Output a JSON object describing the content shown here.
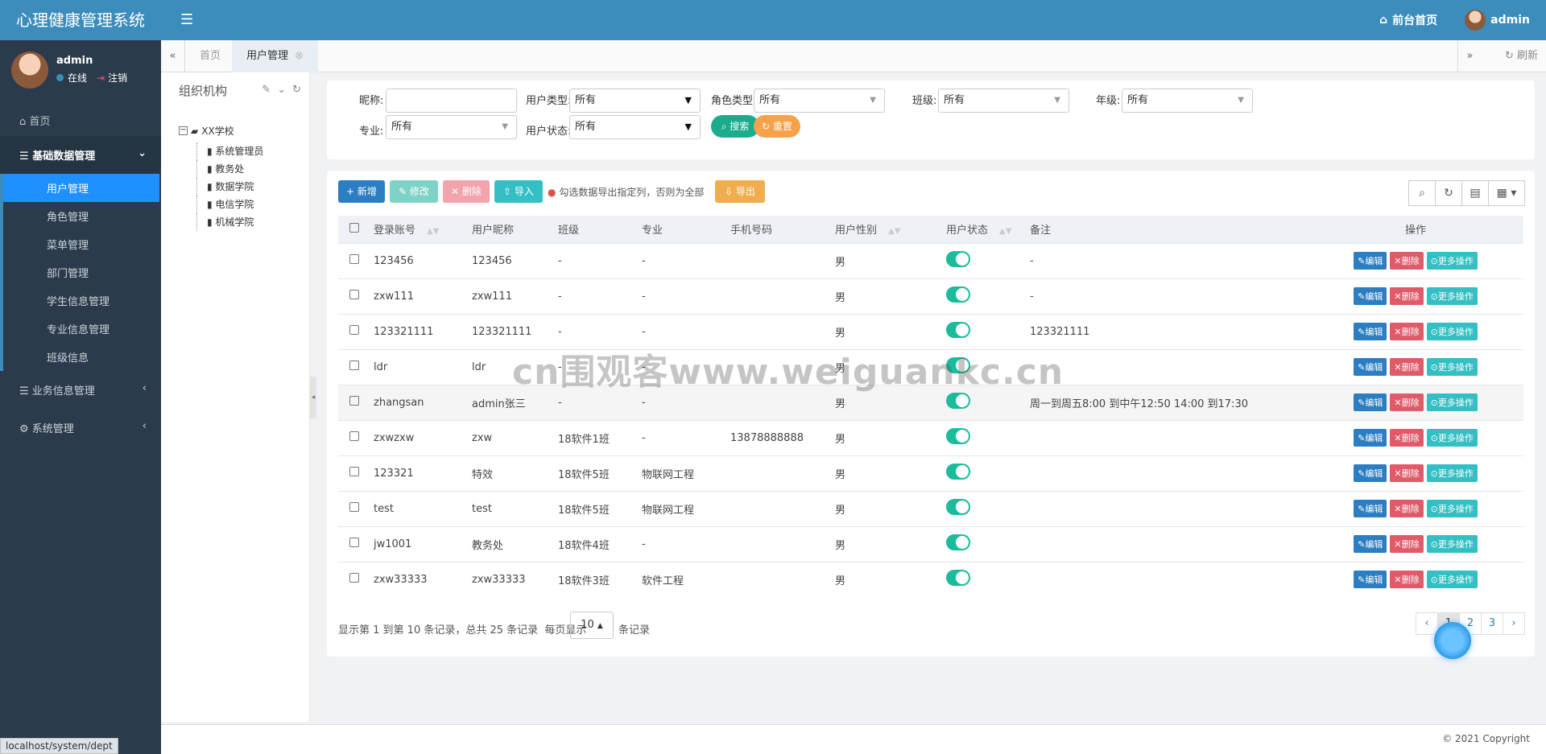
{
  "app": {
    "title": "心理健康管理系统"
  },
  "topbar": {
    "home_link": "前台首页",
    "user": "admin"
  },
  "sidebar": {
    "user": "admin",
    "status_online": "在线",
    "logout": "注销",
    "home": "首页",
    "group_basic": "基础数据管理",
    "sub_items": [
      "用户管理",
      "角色管理",
      "菜单管理",
      "部门管理",
      "学生信息管理",
      "专业信息管理",
      "班级信息"
    ],
    "group_business": "业务信息管理",
    "group_system": "系统管理"
  },
  "tabs": {
    "items": [
      "首页",
      "用户管理"
    ],
    "refresh": "刷新"
  },
  "org": {
    "title": "组织机构",
    "root": "XX学校",
    "children": [
      "系统管理员",
      "教务处",
      "数据学院",
      "电信学院",
      "机械学院"
    ]
  },
  "filter": {
    "nickname_label": "昵称:",
    "nickname_value": "",
    "user_type_label": "用户类型:",
    "user_type_value": "所有",
    "role_type_label": "角色类型:",
    "role_type_value": "所有",
    "class_label": "班级:",
    "class_value": "所有",
    "grade_label": "年级:",
    "grade_value": "所有",
    "major_label": "专业:",
    "major_value": "所有",
    "user_status_label": "用户状态:",
    "user_status_value": "所有",
    "search_btn": "搜索",
    "reset_btn": "重置"
  },
  "toolbar": {
    "add": "新增",
    "edit": "修改",
    "delete": "删除",
    "import": "导入",
    "export_hint": "勾选数据导出指定列，否则为全部",
    "export": "导出"
  },
  "table": {
    "headers": [
      "登录账号",
      "用户昵称",
      "班级",
      "专业",
      "手机号码",
      "用户性别",
      "用户状态",
      "备注",
      "操作"
    ],
    "rows": [
      {
        "account": "123456",
        "nick": "123456",
        "cls": "-",
        "major": "-",
        "phone": "",
        "gender": "男",
        "remark": "-"
      },
      {
        "account": "zxw111",
        "nick": "zxw111",
        "cls": "-",
        "major": "-",
        "phone": "",
        "gender": "男",
        "remark": "-"
      },
      {
        "account": "123321111",
        "nick": "123321111",
        "cls": "-",
        "major": "-",
        "phone": "",
        "gender": "男",
        "remark": "123321111"
      },
      {
        "account": "ldr",
        "nick": "ldr",
        "cls": "-",
        "major": "-",
        "phone": "",
        "gender": "男",
        "remark": ""
      },
      {
        "account": "zhangsan",
        "nick": "admin张三",
        "cls": "-",
        "major": "-",
        "phone": "",
        "gender": "男",
        "remark": "周一到周五8:00 到中午12:50 14:00 到17:30"
      },
      {
        "account": "zxwzxw",
        "nick": "zxw",
        "cls": "18软件1班",
        "major": "-",
        "phone": "13878888888",
        "gender": "男",
        "remark": ""
      },
      {
        "account": "123321",
        "nick": "特效",
        "cls": "18软件5班",
        "major": "物联网工程",
        "phone": "",
        "gender": "男",
        "remark": ""
      },
      {
        "account": "test",
        "nick": "test",
        "cls": "18软件5班",
        "major": "物联网工程",
        "phone": "",
        "gender": "男",
        "remark": ""
      },
      {
        "account": "jw1001",
        "nick": "教务处",
        "cls": "18软件4班",
        "major": "-",
        "phone": "",
        "gender": "男",
        "remark": ""
      },
      {
        "account": "zxw33333",
        "nick": "zxw33333",
        "cls": "18软件3班",
        "major": "软件工程",
        "phone": "",
        "gender": "男",
        "remark": ""
      }
    ],
    "op_edit": "编辑",
    "op_delete": "删除",
    "op_more": "更多操作"
  },
  "pager": {
    "summary": "显示第 1 到第 10 条记录，总共 25 条记录",
    "per_page_label": "每页显示",
    "page_size": "10",
    "records_label": "条记录",
    "prev": "‹",
    "pages": [
      "1",
      "2",
      "3"
    ],
    "next": "›"
  },
  "footer": {
    "copyright": "© 2021 Copyright"
  },
  "status_url": "localhost/system/dept",
  "watermark": "cn围观客www.weiguankc.cn",
  "colors": {
    "primary": "#3c8dbc",
    "sidebar": "#2b3b4b",
    "active": "#1e90ff",
    "green": "#1abc9c",
    "red": "#e05a6a",
    "orange": "#f0ad4e"
  }
}
